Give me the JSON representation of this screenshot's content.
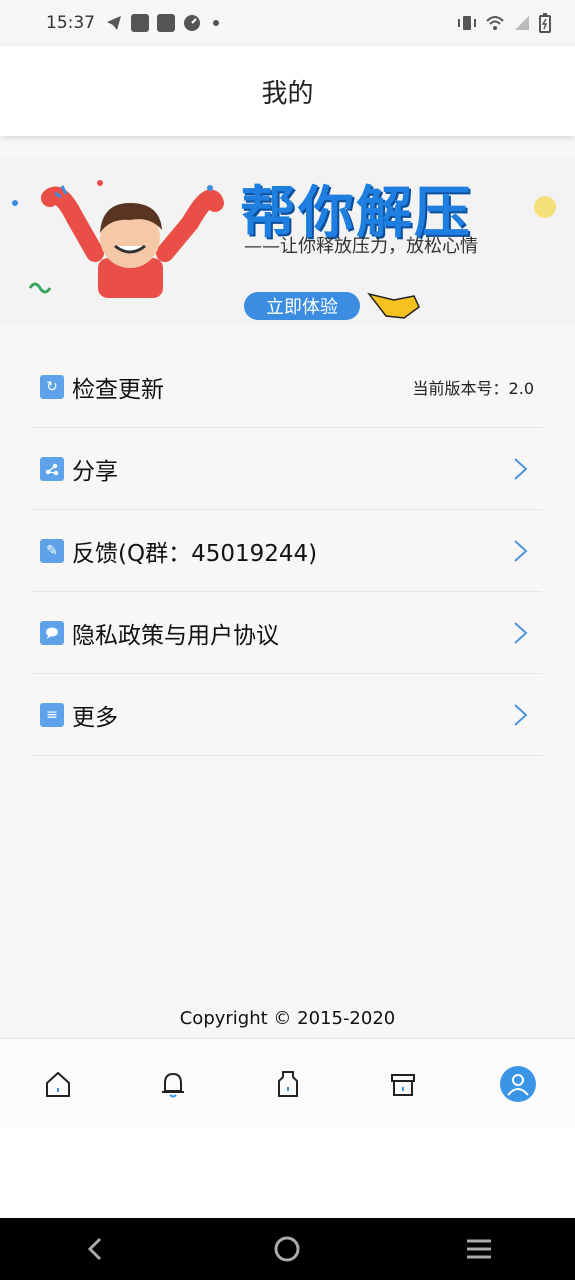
{
  "status_bar": {
    "time": "15:37"
  },
  "app_bar": {
    "title": "我的"
  },
  "banner": {
    "title": "帮你解压",
    "subtitle": "——让你释放压力，放松心情",
    "button": "立即体验"
  },
  "menu": {
    "items": [
      {
        "label": "检查更新",
        "value": "当前版本号：2.0"
      },
      {
        "label": "分享"
      },
      {
        "label": "反馈(Q群：45019244)"
      },
      {
        "label": "隐私政策与用户协议"
      },
      {
        "label": "更多"
      }
    ]
  },
  "footer": {
    "copyright": "Copyright © 2015-2020"
  },
  "colors": {
    "accent": "#3b95e6",
    "banner_title": "#1e7fe0"
  }
}
